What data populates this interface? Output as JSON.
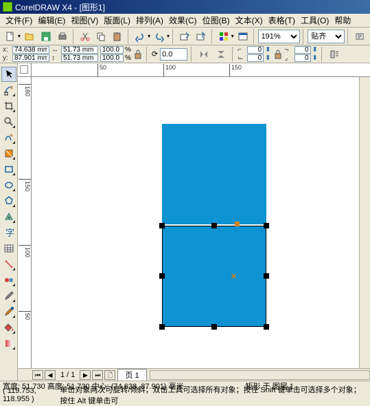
{
  "title": "CorelDRAW X4 - [图形1]",
  "menu": {
    "file": "文件(F)",
    "edit": "编辑(E)",
    "view": "视图(V)",
    "layout": "版面(L)",
    "arrange": "排列(A)",
    "effects": "效果(C)",
    "bitmap": "位图(B)",
    "text": "文本(X)",
    "table": "表格(T)",
    "tools": "工具(O)",
    "help": "帮助"
  },
  "zoom": "191%",
  "snap": "贴齐",
  "pos": {
    "x_label": "x:",
    "x": "74.638 mm",
    "y_label": "y:",
    "y": "87.901 mm"
  },
  "size": {
    "w": "51.73 mm",
    "h": "51.73 mm"
  },
  "scale": {
    "x": "100.0",
    "y": "100.0",
    "unit": "%"
  },
  "rotate": "0.0",
  "corner": {
    "a": "0",
    "b": "0",
    "c": "0",
    "d": "0"
  },
  "page": {
    "count": "1 / 1",
    "tab": "页 1"
  },
  "status1": {
    "w_lbl": "宽度:",
    "w": "51.730",
    "h_lbl": "高度:",
    "h": "51.730",
    "c_lbl": "中心:",
    "c": "(74.638, 87.901)",
    "unit": "毫米",
    "obj": "矩形 于 图层 1"
  },
  "status2": {
    "coord": "( 119.753, 118.955 )",
    "hint": "单击对象两次可旋转/倾斜；双击工具可选择所有对象；按住 Shift 键单击可选择多个对象；按住 Alt 键单击可"
  },
  "ruler_h_ticks": [
    "50",
    "100",
    "150"
  ],
  "ruler_v_ticks": [
    "50",
    "100",
    "150",
    "180"
  ]
}
